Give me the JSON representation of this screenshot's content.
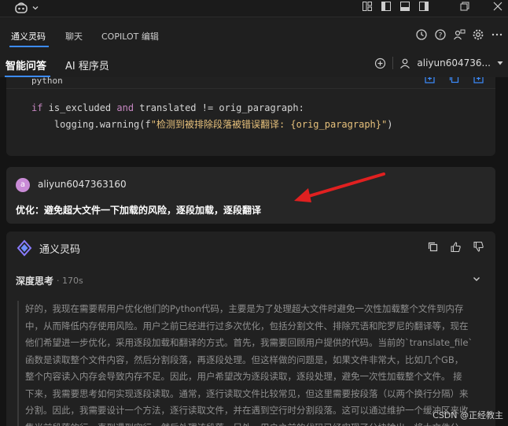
{
  "titlebar": {
    "logo_icon": "copilot-logo-icon",
    "icons": [
      "layout-icon",
      "panel-left-icon",
      "panel-bottom-icon",
      "panel-right-icon",
      "restore-icon",
      "close-icon"
    ]
  },
  "tabs_primary": {
    "items": [
      {
        "label": "通义灵码",
        "active": true
      },
      {
        "label": "聊天",
        "active": false
      },
      {
        "label": "COPILOT 编辑",
        "active": false
      }
    ],
    "icons": [
      "history-icon",
      "help-icon",
      "person-feedback-icon",
      "settings-icon",
      "more-icon"
    ]
  },
  "tabs_secondary": {
    "items": [
      {
        "label": "智能问答",
        "active": true
      },
      {
        "label": "AI 程序员",
        "active": false
      }
    ],
    "user": "aliyun604736..."
  },
  "code_block": {
    "language": "python",
    "line1": {
      "kw1": "if",
      "t1": " is_excluded ",
      "kw2": "and",
      "t2": " translated != orig_paragraph:"
    },
    "line2": {
      "t1": "    logging.warning(f",
      "s1": "\"检测到被排除段落被错误翻译: {orig_paragraph}\"",
      "t2": ")"
    },
    "actions": [
      "insert-icon",
      "copy-icon",
      "new-file-icon"
    ]
  },
  "user_message": {
    "avatar_letter": "a",
    "username": "aliyun6047363160",
    "text": "优化：避免超大文件一下加载的风险，逐段加载，逐段翻译"
  },
  "assistant": {
    "name": "通义灵码",
    "actions": [
      "copy-icon",
      "thumbs-up-icon",
      "thumbs-down-icon"
    ],
    "thinking_title": "深度思考",
    "thinking_time": "· 170s",
    "thinking_lines": [
      "好的，我现在需要帮用户优化他们的Python代码，主要是为了处理超大文件时避免一次性加载整个文件到内存",
      "中，从而降低内存使用风险。用户之前已经进行过多次优化，包括分割文件、排除咒语和陀罗尼的翻译等，现在",
      "他们希望进一步优化，采用逐段加载和翻译的方式。首先，我需要回顾用户提供的代码。当前的`translate_file`",
      "函数是读取整个文件内容，然后分割段落，再逐段处理。但这样做的问题是，如果文件非常大，比如几个GB，",
      "整个内容读入内存会导致内存不足。因此，用户希望改为逐段读取，逐段处理，避免一次性加载整个文件。 接",
      "下来，我需要思考如何实现逐段读取。通常，逐行读取文件比较常见，但这里需要按段落（以两个换行分隔）来",
      "分割。因此，我需要设计一个方法，逐行读取文件，并在遇到空行时分割段落。这可以通过维护一个缓冲区来收",
      "集当前段落的行，直到遇到空行，然后处理该段落。另外，用户之前的代码已经实现了分块输出，将大文件分"
    ]
  },
  "watermark": "CSDN @正经教主",
  "colors": {
    "accent": "#3c8cff",
    "arrow": "#e02020",
    "keyword": "#c586c0",
    "string": "#e6c07b",
    "avatar": "#c98bd6"
  }
}
